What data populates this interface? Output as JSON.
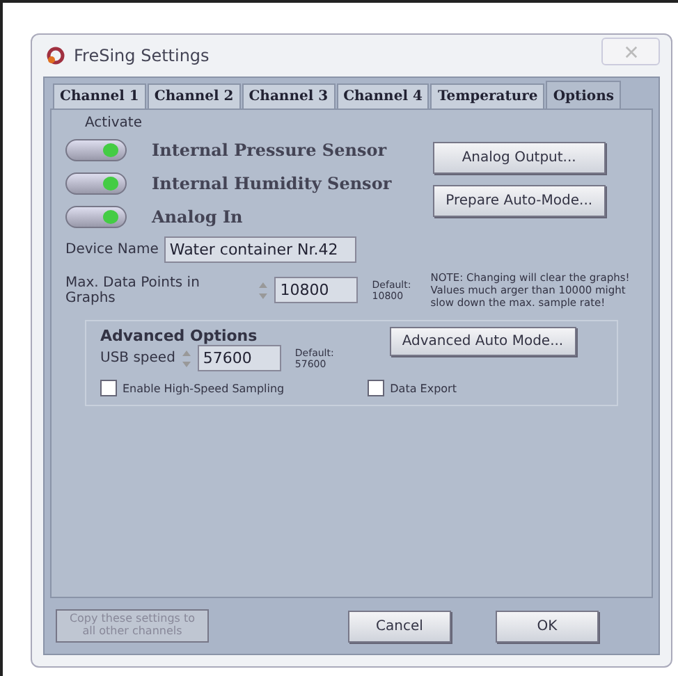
{
  "window": {
    "title": "FreSing Settings"
  },
  "tabs": [
    {
      "label": "Channel 1",
      "selected": false
    },
    {
      "label": "Channel 2",
      "selected": false
    },
    {
      "label": "Channel 3",
      "selected": false
    },
    {
      "label": "Channel 4",
      "selected": false
    },
    {
      "label": "Temperature",
      "selected": false
    },
    {
      "label": "Options",
      "selected": true
    }
  ],
  "activate_label": "Activate",
  "sensors": [
    {
      "label": "Internal Pressure Sensor",
      "on": true
    },
    {
      "label": "Internal Humidity Sensor",
      "on": true
    },
    {
      "label": "Analog In",
      "on": true
    }
  ],
  "side_buttons": [
    "Analog Output...",
    "Prepare Auto-Mode..."
  ],
  "device_name": {
    "label": "Device Name",
    "value": "Water container Nr.42"
  },
  "max_points": {
    "label": "Max. Data Points in Graphs",
    "value": "10800",
    "default_label": "Default:",
    "default_value": "10800",
    "note": "NOTE: Changing will clear the graphs! Values much arger than 10000 might slow down the max. sample rate!"
  },
  "advanced": {
    "title": "Advanced Options",
    "button": "Advanced Auto Mode...",
    "usb": {
      "label": "USB speed",
      "value": "57600",
      "default_label": "Default:",
      "default_value": "57600"
    },
    "checkboxes": [
      {
        "label": "Enable High-Speed Sampling",
        "checked": false
      },
      {
        "label": "Data Export",
        "checked": false
      }
    ]
  },
  "footer": {
    "copy": {
      "label": "Copy these settings to all other channels",
      "disabled": true
    },
    "buttons": [
      "Cancel",
      "OK"
    ]
  }
}
